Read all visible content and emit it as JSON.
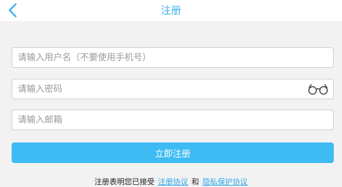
{
  "header": {
    "title": "注册",
    "back_icon": "chevron-left-icon"
  },
  "form": {
    "username_placeholder": "请输入用户名（不要使用手机号）",
    "username_value": "",
    "password_placeholder": "请输入密码",
    "password_value": "",
    "password_toggle_icon": "glasses-icon",
    "email_placeholder": "请输入邮箱",
    "email_value": "",
    "submit_label": "立即注册"
  },
  "agreement": {
    "prefix": "注册表明您已接受",
    "terms_link": "注册协议",
    "conjunction": "和",
    "privacy_link": "隐私保护协议"
  },
  "colors": {
    "accent": "#3cb4ee",
    "button": "#3ebbf2",
    "background": "#f2f2f2"
  }
}
